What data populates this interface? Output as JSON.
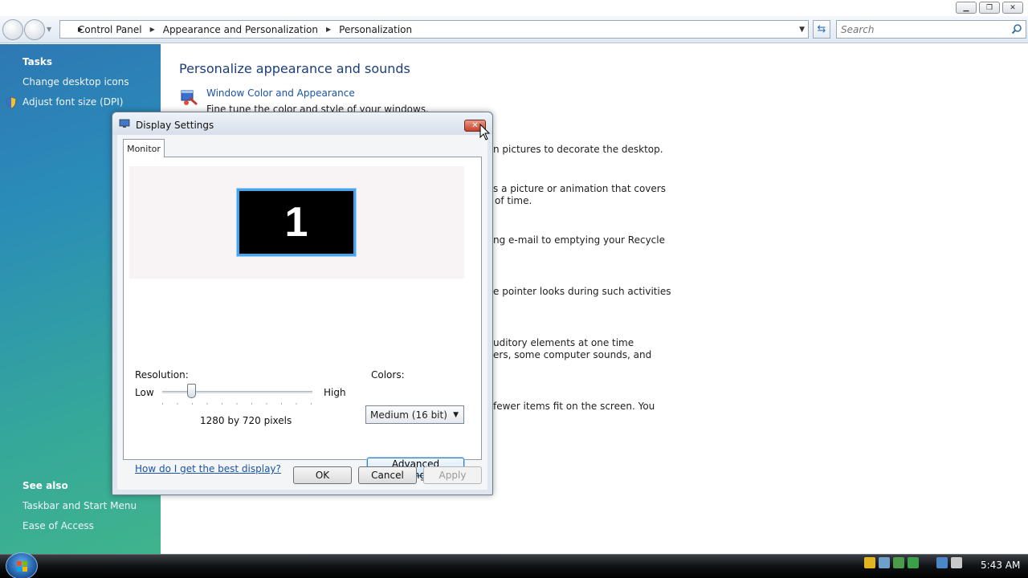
{
  "window": {
    "controls": [
      "minimize",
      "maximize",
      "close"
    ]
  },
  "address": {
    "breadcrumbs": [
      "Control Panel",
      "Appearance and Personalization",
      "Personalization"
    ],
    "search_placeholder": "Search"
  },
  "sidebar": {
    "tasks_heading": "Tasks",
    "tasks": [
      "Change desktop icons",
      "Adjust font size (DPI)"
    ],
    "see_also_heading": "See also",
    "see_also": [
      "Taskbar and Start Menu",
      "Ease of Access"
    ]
  },
  "main": {
    "title": "Personalize appearance and sounds",
    "first_item_link": "Window Color and Appearance",
    "first_item_desc": "Fine tune the color and style of your windows.",
    "desc_fragments": [
      "n pictures to decorate the desktop.",
      "s a picture or animation that covers",
      "of time.",
      "ng e-mail to emptying your Recycle",
      "e pointer looks during such activities",
      "uditory elements at one time",
      "ers, some computer sounds, and",
      "fewer items fit on the screen. You"
    ]
  },
  "dialog": {
    "title": "Display Settings",
    "tab": "Monitor",
    "monitor_number": "1",
    "resolution_label": "Resolution:",
    "low_label": "Low",
    "high_label": "High",
    "resolution_value": "1280 by 720 pixels",
    "resolution_slider_position": 0.19,
    "colors_label": "Colors:",
    "colors_value": "Medium (16 bit)",
    "help_link": "How do I get the best display?",
    "advanced_button": "Advanced Settings...",
    "ok_button": "OK",
    "cancel_button": "Cancel",
    "apply_button": "Apply"
  },
  "taskbar": {
    "clock": "5:43 AM"
  },
  "colors": {
    "link": "#1a53a6",
    "title": "#1b3e7a",
    "monitor_highlight": "#4aa3e8"
  }
}
